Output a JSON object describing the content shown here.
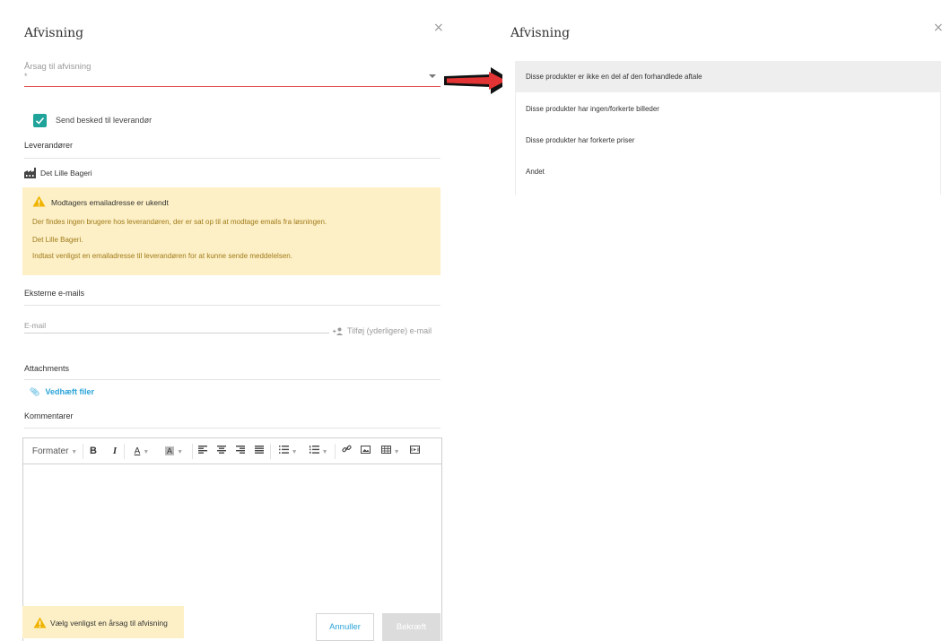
{
  "left_dialog": {
    "title": "Afvisning",
    "close_glyph": "×",
    "reason_label": "Årsag til afvisning",
    "reason_required": "*",
    "send_message_label": "Send besked til leverandør",
    "send_message_checked": true,
    "suppliers_heading": "Leverandører",
    "supplier_name": "Det Lille Bageri",
    "warning": {
      "title": "Modtagers emailadresse er ukendt",
      "lines": [
        "Der findes ingen brugere hos leverandøren, der er sat op til at modtage emails fra løsningen.",
        "Det Lille Bageri.",
        "Indtast venligst en emailadresse til leverandøren for at kunne sende meddelelsen."
      ]
    },
    "external_emails_heading": "Eksterne e-mails",
    "email_placeholder": "E-mail",
    "add_email_label": "Tilføj (yderligere) e-mail",
    "attachments_heading": "Attachments",
    "attach_files_label": "Vedhæft filer",
    "comments_heading": "Kommentarer",
    "toolbar": {
      "format_label": "Formater",
      "bold": "B",
      "italic": "I",
      "font_color": "A",
      "bg_color": "A"
    },
    "validation_message": "Vælg venligst en årsag til afvisning",
    "cancel_label": "Annuller",
    "confirm_label": "Bekræft"
  },
  "right_dialog": {
    "title": "Afvisning",
    "close_glyph": "×",
    "options": [
      "Disse produkter er ikke en del af den forhandlede aftale",
      "Disse produkter har ingen/forkerte billeder",
      "Disse produkter har forkerte priser",
      "Andet"
    ],
    "selected_index": 0
  },
  "colors": {
    "accent_teal": "#1fa39a",
    "link_blue": "#2aa4d7",
    "error_red": "#e05252",
    "warning_bg": "#fdf0c6",
    "arrow_red": "#e23434"
  }
}
